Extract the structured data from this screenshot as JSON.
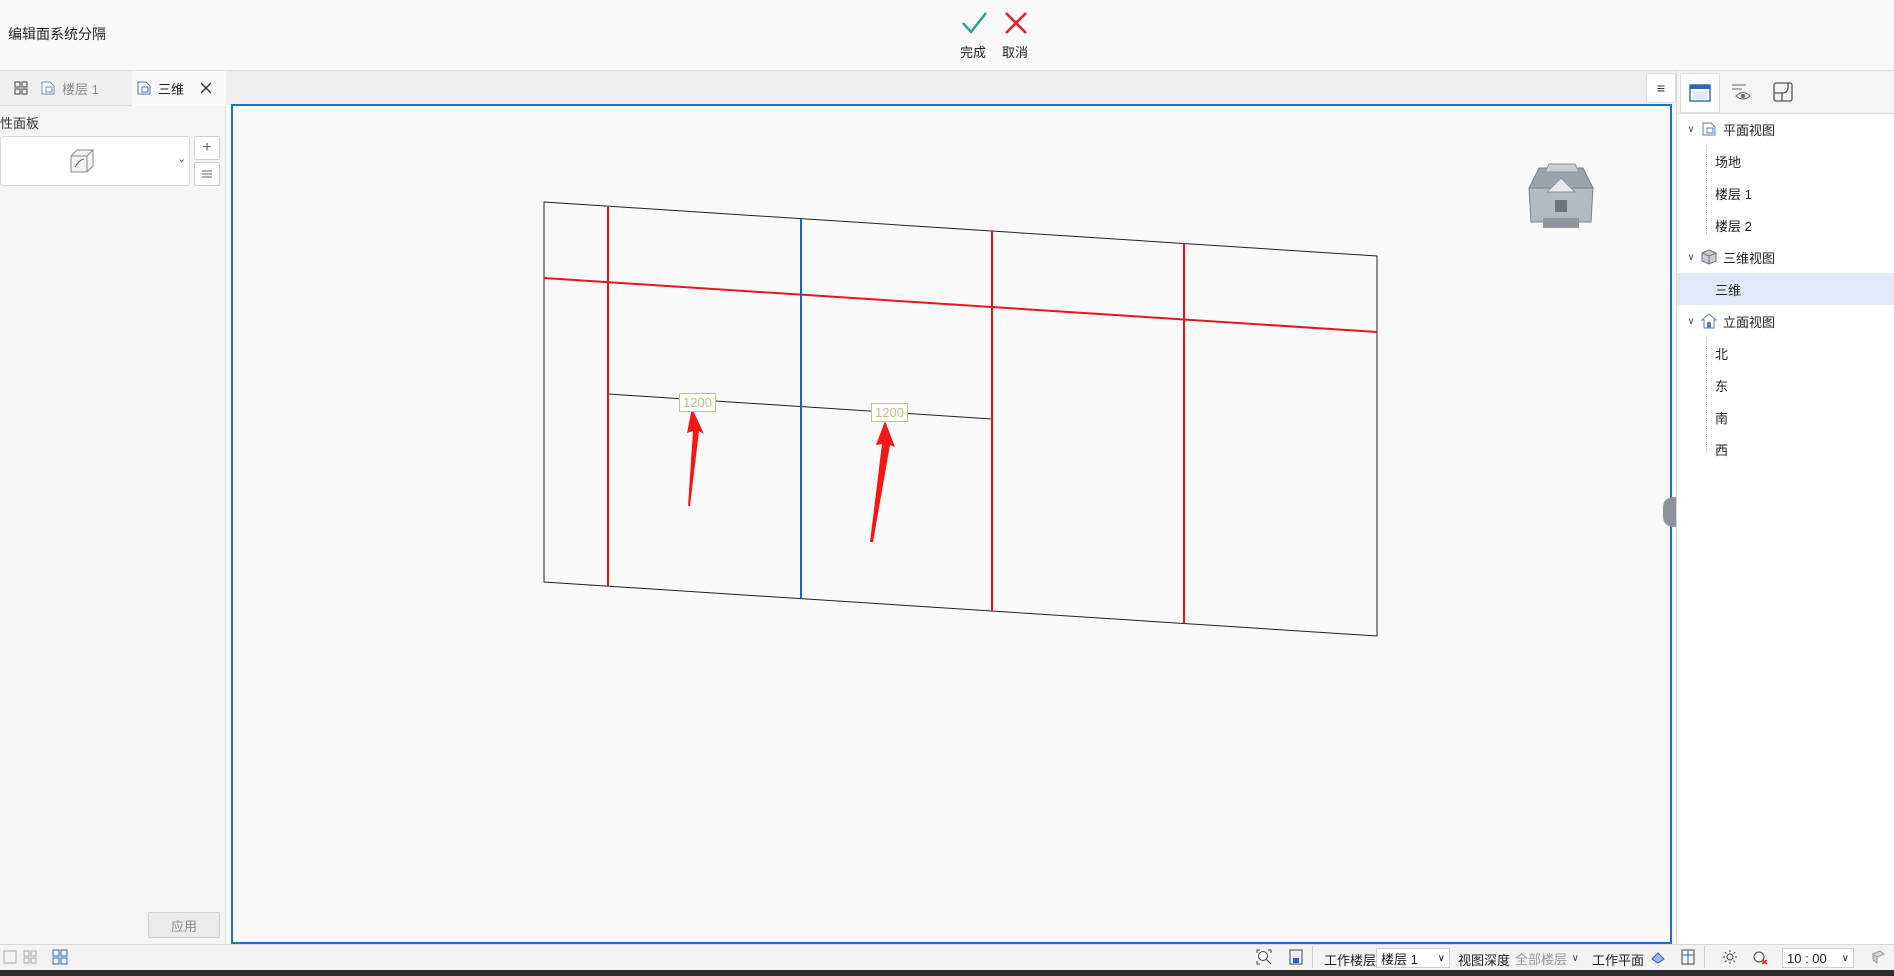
{
  "app": {
    "title": "编辑面系统分隔"
  },
  "toolbar": {
    "done_label": "完成",
    "cancel_label": "取消",
    "done_color": "#1aa58f",
    "cancel_color": "#e0252b"
  },
  "tabs": [
    {
      "label": "楼层 1",
      "active": false
    },
    {
      "label": "三维",
      "active": true
    }
  ],
  "left_panel": {
    "title": "属性面板",
    "title_visible_part": "性面板",
    "apply_label": "应用"
  },
  "viewport": {
    "dimension_labels": [
      "1200",
      "1200"
    ],
    "grid_line_color": "#e8161b",
    "selected_line_color": "#1e5fc4"
  },
  "project_tree": {
    "groups": [
      {
        "label": "平面视图",
        "icon": "floor-plan-icon",
        "children": [
          "场地",
          "楼层 1",
          "楼层 2"
        ]
      },
      {
        "label": "三维视图",
        "icon": "cube-icon",
        "children": [
          "三维"
        ]
      },
      {
        "label": "立面视图",
        "icon": "house-elevation-icon",
        "children": [
          "北",
          "东",
          "南",
          "西"
        ]
      }
    ],
    "selected": "三维"
  },
  "status_bar": {
    "work_floor_label": "工作楼层",
    "work_floor_value": "楼层 1",
    "view_depth_label": "视图深度",
    "view_depth_value": "全部楼层",
    "work_plane_label": "工作平面",
    "time_value": "10 : 00"
  }
}
